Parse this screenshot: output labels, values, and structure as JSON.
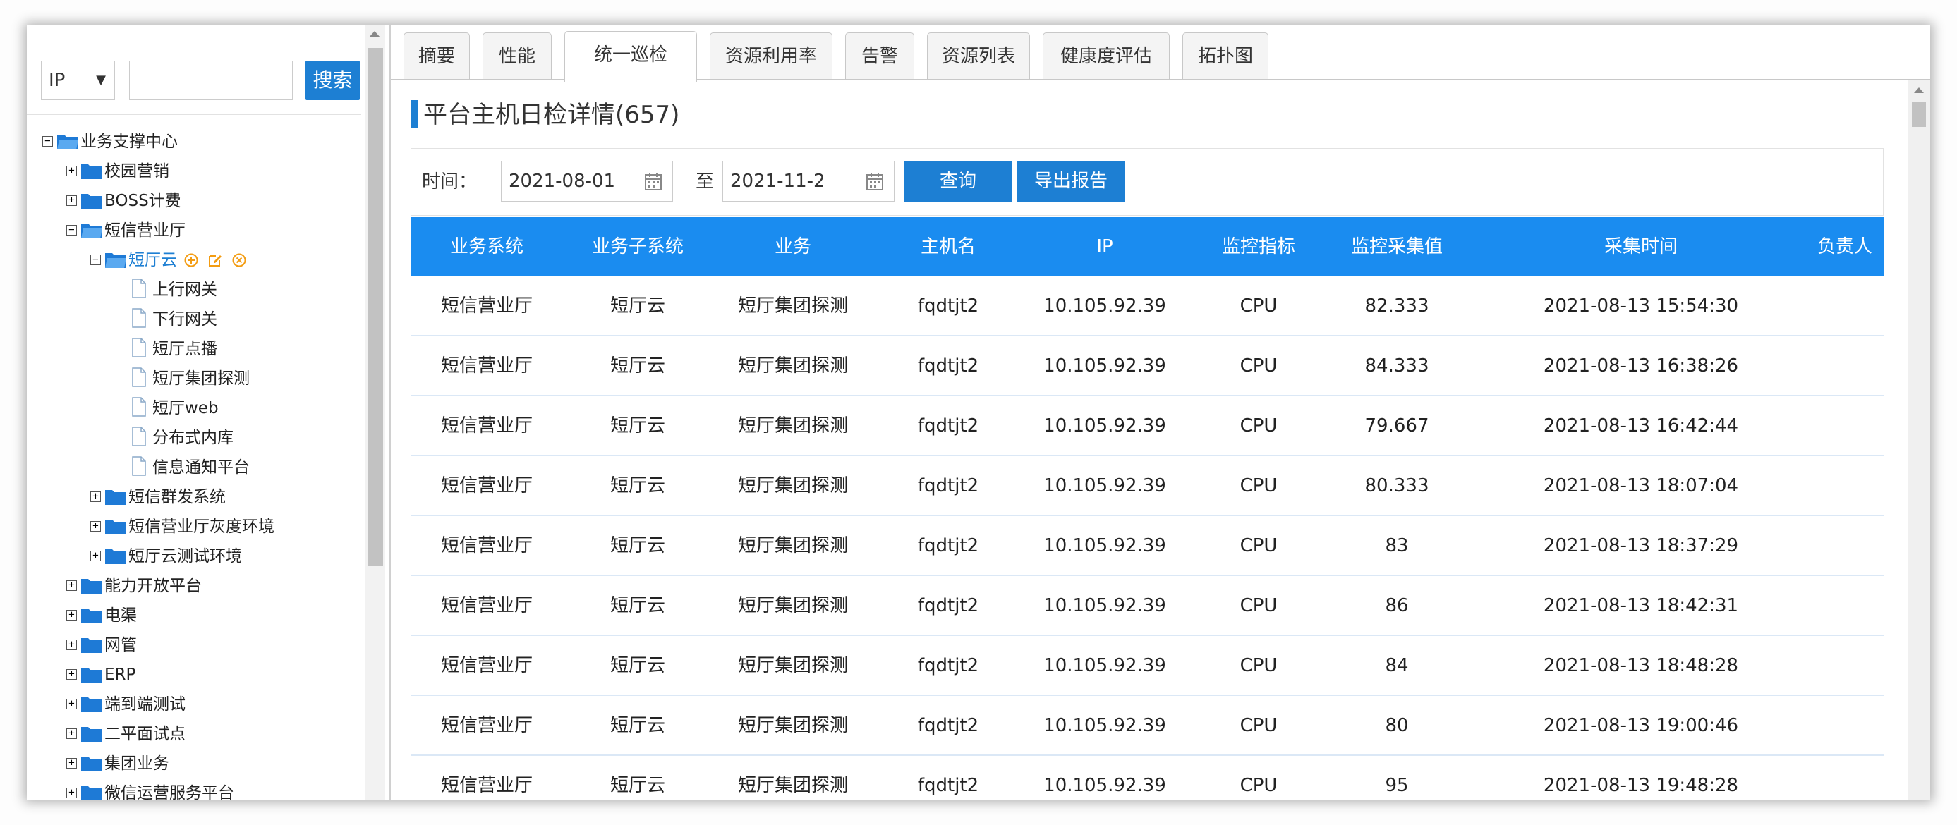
{
  "search": {
    "select_value": "IP",
    "input_value": "",
    "button_label": "搜索"
  },
  "tree": [
    {
      "label": "业务支撑中心",
      "toggle": "⊟",
      "open": true
    },
    {
      "label": "校园营销",
      "toggle": "⊞"
    },
    {
      "label": "BOSS计费",
      "toggle": "⊞"
    },
    {
      "label": "短信营业厅",
      "toggle": "⊟",
      "open": true
    },
    {
      "label": "短厅云",
      "toggle": "⊟",
      "open": true,
      "selected": true
    },
    {
      "label": "上行网关"
    },
    {
      "label": "下行网关"
    },
    {
      "label": "短厅点播"
    },
    {
      "label": "短厅集团探测"
    },
    {
      "label": "短厅web"
    },
    {
      "label": "分布式内库"
    },
    {
      "label": "信息通知平台"
    },
    {
      "label": "短信群发系统",
      "toggle": "⊞"
    },
    {
      "label": "短信营业厅灰度环境",
      "toggle": "⊞"
    },
    {
      "label": "短厅云测试环境",
      "toggle": "⊞"
    },
    {
      "label": "能力开放平台",
      "toggle": "⊞"
    },
    {
      "label": "电渠",
      "toggle": "⊞"
    },
    {
      "label": "网管",
      "toggle": "⊞"
    },
    {
      "label": "ERP",
      "toggle": "⊞"
    },
    {
      "label": "端到端测试",
      "toggle": "⊞"
    },
    {
      "label": "二平面试点",
      "toggle": "⊞"
    },
    {
      "label": "集团业务",
      "toggle": "⊞"
    },
    {
      "label": "微信运营服务平台",
      "toggle": "⊞"
    }
  ],
  "tree_actions": [
    "add-icon",
    "edit-icon",
    "delete-icon"
  ],
  "tabs": [
    {
      "label": "摘要"
    },
    {
      "label": "性能"
    },
    {
      "label": "统一巡检",
      "active": true
    },
    {
      "label": "资源利用率"
    },
    {
      "label": "告警"
    },
    {
      "label": "资源列表"
    },
    {
      "label": "健康度评估"
    },
    {
      "label": "拓扑图"
    }
  ],
  "main": {
    "title": "平台主机日检详情(657)"
  },
  "filter": {
    "time_label": "时间：",
    "start_date": "2021-08-01",
    "to_label": "至",
    "end_date": "2021-11-2",
    "query_label": "查询",
    "export_label": "导出报告"
  },
  "table": {
    "columns": [
      "业务系统",
      "业务子系统",
      "业务",
      "主机名",
      "IP",
      "监控指标",
      "监控采集值",
      "采集时间",
      "负责人"
    ],
    "rows": [
      [
        "短信营业厅",
        "短厅云",
        "短厅集团探测",
        "fqdtjt2",
        "10.105.92.39",
        "CPU",
        "82.333",
        "2021-08-13 15:54:30",
        ""
      ],
      [
        "短信营业厅",
        "短厅云",
        "短厅集团探测",
        "fqdtjt2",
        "10.105.92.39",
        "CPU",
        "84.333",
        "2021-08-13 16:38:26",
        ""
      ],
      [
        "短信营业厅",
        "短厅云",
        "短厅集团探测",
        "fqdtjt2",
        "10.105.92.39",
        "CPU",
        "79.667",
        "2021-08-13 16:42:44",
        ""
      ],
      [
        "短信营业厅",
        "短厅云",
        "短厅集团探测",
        "fqdtjt2",
        "10.105.92.39",
        "CPU",
        "80.333",
        "2021-08-13 18:07:04",
        ""
      ],
      [
        "短信营业厅",
        "短厅云",
        "短厅集团探测",
        "fqdtjt2",
        "10.105.92.39",
        "CPU",
        "83",
        "2021-08-13 18:37:29",
        ""
      ],
      [
        "短信营业厅",
        "短厅云",
        "短厅集团探测",
        "fqdtjt2",
        "10.105.92.39",
        "CPU",
        "86",
        "2021-08-13 18:42:31",
        ""
      ],
      [
        "短信营业厅",
        "短厅云",
        "短厅集团探测",
        "fqdtjt2",
        "10.105.92.39",
        "CPU",
        "84",
        "2021-08-13 18:48:28",
        ""
      ],
      [
        "短信营业厅",
        "短厅云",
        "短厅集团探测",
        "fqdtjt2",
        "10.105.92.39",
        "CPU",
        "80",
        "2021-08-13 19:00:46",
        ""
      ],
      [
        "短信营业厅",
        "短厅云",
        "短厅集团探测",
        "fqdtjt2",
        "10.105.92.39",
        "CPU",
        "95",
        "2021-08-13 19:48:28",
        ""
      ]
    ]
  },
  "colors": {
    "accent": "#1d7fd3",
    "table_header": "#1a8cf0",
    "row_divider": "#dbe8f6",
    "folder": "#1e7ad6",
    "action_icon": "#f39c12"
  }
}
